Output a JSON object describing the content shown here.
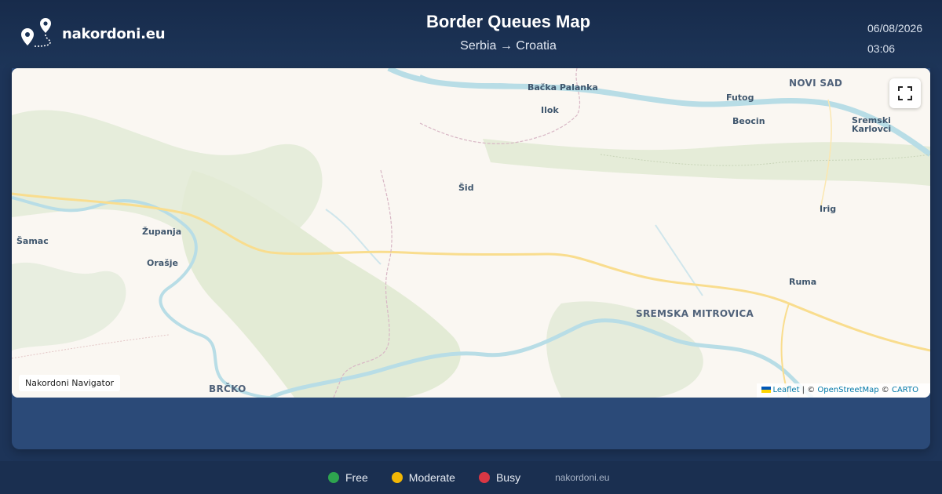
{
  "header": {
    "brand": "nakordoni.eu",
    "title": "Border Queues Map",
    "subtitle": "Serbia → Croatia",
    "date": "06/08/2026",
    "time": "03:06"
  },
  "map": {
    "places": [
      {
        "name": "Bačka Palanka",
        "size": "mid"
      },
      {
        "name": "NOVI SAD",
        "size": "big"
      },
      {
        "name": "Ilok",
        "size": "mid"
      },
      {
        "name": "Futog",
        "size": "mid"
      },
      {
        "name": "Beocin",
        "size": "mid"
      },
      {
        "name": "Sremski\nKarlovci",
        "size": "mid"
      },
      {
        "name": "Šid",
        "size": "mid"
      },
      {
        "name": "Irig",
        "size": "mid"
      },
      {
        "name": "Šamac",
        "size": "mid"
      },
      {
        "name": "Županja",
        "size": "mid"
      },
      {
        "name": "Orašje",
        "size": "mid"
      },
      {
        "name": "Ruma",
        "size": "mid"
      },
      {
        "name": "SREMSKA MITROVICA",
        "size": "big"
      },
      {
        "name": "BRČKO",
        "size": "big"
      }
    ],
    "fullscreen_icon": "expand-icon",
    "navigator_label": "Nakordoni Navigator",
    "attribution": {
      "leaflet": "Leaflet",
      "sep1": " | © ",
      "osm": "OpenStreetMap",
      "sep2": " © ",
      "carto": "CARTO"
    },
    "colors": {
      "land": "#faf7f2",
      "forest": "#e4ecd8",
      "river": "#b8dde6",
      "road": "#f9dd8e",
      "border": "#d8b7c5"
    }
  },
  "legend": {
    "items": [
      {
        "label": "Free",
        "color": "#2ea44f"
      },
      {
        "label": "Moderate",
        "color": "#f2b705"
      },
      {
        "label": "Busy",
        "color": "#d93744"
      }
    ],
    "site": "nakordoni.eu"
  }
}
